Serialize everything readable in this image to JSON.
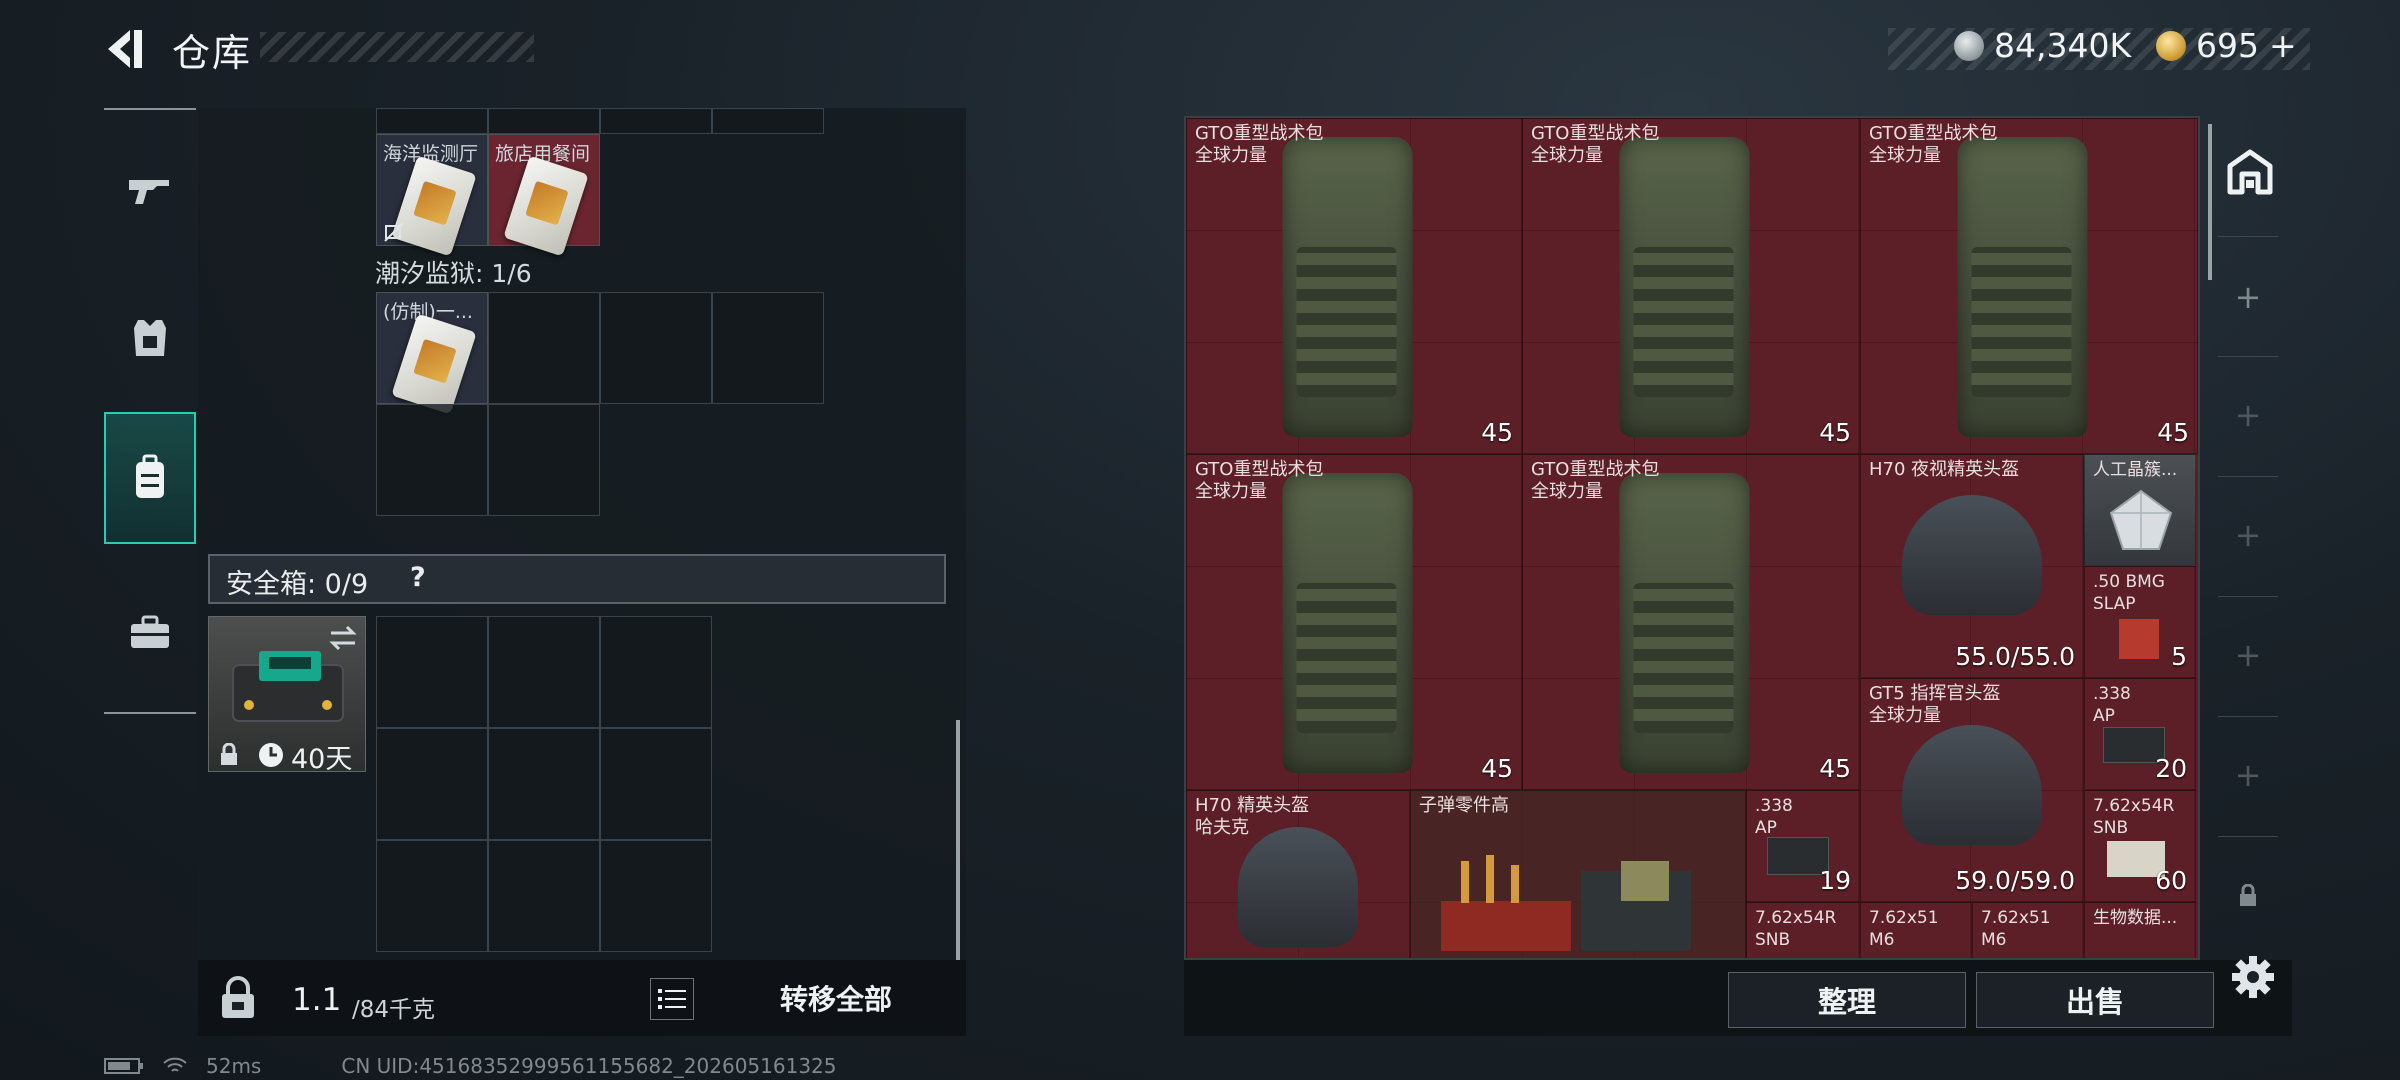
{
  "header": {
    "title": "仓库"
  },
  "currency": {
    "coins": "84,340K",
    "premium": "695",
    "plus": "+"
  },
  "left_nav": {
    "items": [
      "weapons",
      "armor",
      "backpack",
      "tools"
    ],
    "active": "backpack"
  },
  "storage": {
    "key_items": [
      {
        "label": "海洋监测厅"
      },
      {
        "label": "旅店用餐间"
      }
    ],
    "tide_prison_label": "潮汐监狱: 1/6",
    "tide_key_label": "(仿制)一...",
    "safe_box_label": "安全箱: 0/9",
    "safe_box_help": "?",
    "safe_item_timer": "40天"
  },
  "footer_left": {
    "weight_value": "1.1",
    "weight_unit": "/84千克",
    "transfer_all": "转移全部"
  },
  "status": {
    "ping": "52ms",
    "uid": "CN UID:45168352999561155682_202605161325"
  },
  "inventory": {
    "items": [
      {
        "name": "GTO重型战术包",
        "sub": "全球力量",
        "count": "45"
      },
      {
        "name": "GTO重型战术包",
        "sub": "全球力量",
        "count": "45"
      },
      {
        "name": "GTO重型战术包",
        "sub": "全球力量",
        "count": "45"
      },
      {
        "name": "GTO重型战术包",
        "sub": "全球力量",
        "count": "45"
      },
      {
        "name": "GTO重型战术包",
        "sub": "全球力量",
        "count": "45"
      },
      {
        "name": "H70 夜视精英头盔",
        "sub": "",
        "count": "55.0/55.0"
      },
      {
        "name": "人工晶簇...",
        "sub": "",
        "count": ""
      },
      {
        "name": ".50 BMG",
        "sub": "SLAP",
        "count": "5"
      },
      {
        "name": "GT5 指挥官头盔",
        "sub": "全球力量",
        "count": "59.0/59.0"
      },
      {
        "name": ".338",
        "sub": "AP",
        "count": "20"
      },
      {
        "name": "H70 精英头盔",
        "sub": "哈夫克",
        "count": ""
      },
      {
        "name": "子弹零件高",
        "sub": "",
        "count": ""
      },
      {
        "name": ".338",
        "sub": "AP",
        "count": "19"
      },
      {
        "name": "7.62x54R",
        "sub": "SNB",
        "count": "60"
      },
      {
        "name": "7.62x54R",
        "sub": "SNB",
        "count": ""
      },
      {
        "name": "7.62x51",
        "sub": "M6",
        "count": ""
      },
      {
        "name": "7.62x51",
        "sub": "M6",
        "count": ""
      },
      {
        "name": "生物数据...",
        "sub": "",
        "count": ""
      }
    ]
  },
  "actions": {
    "sort": "整理",
    "sell": "出售"
  },
  "colors": {
    "accent": "#1fd1b0",
    "slot_red": "#5c1f27",
    "panel": "#161c21"
  }
}
